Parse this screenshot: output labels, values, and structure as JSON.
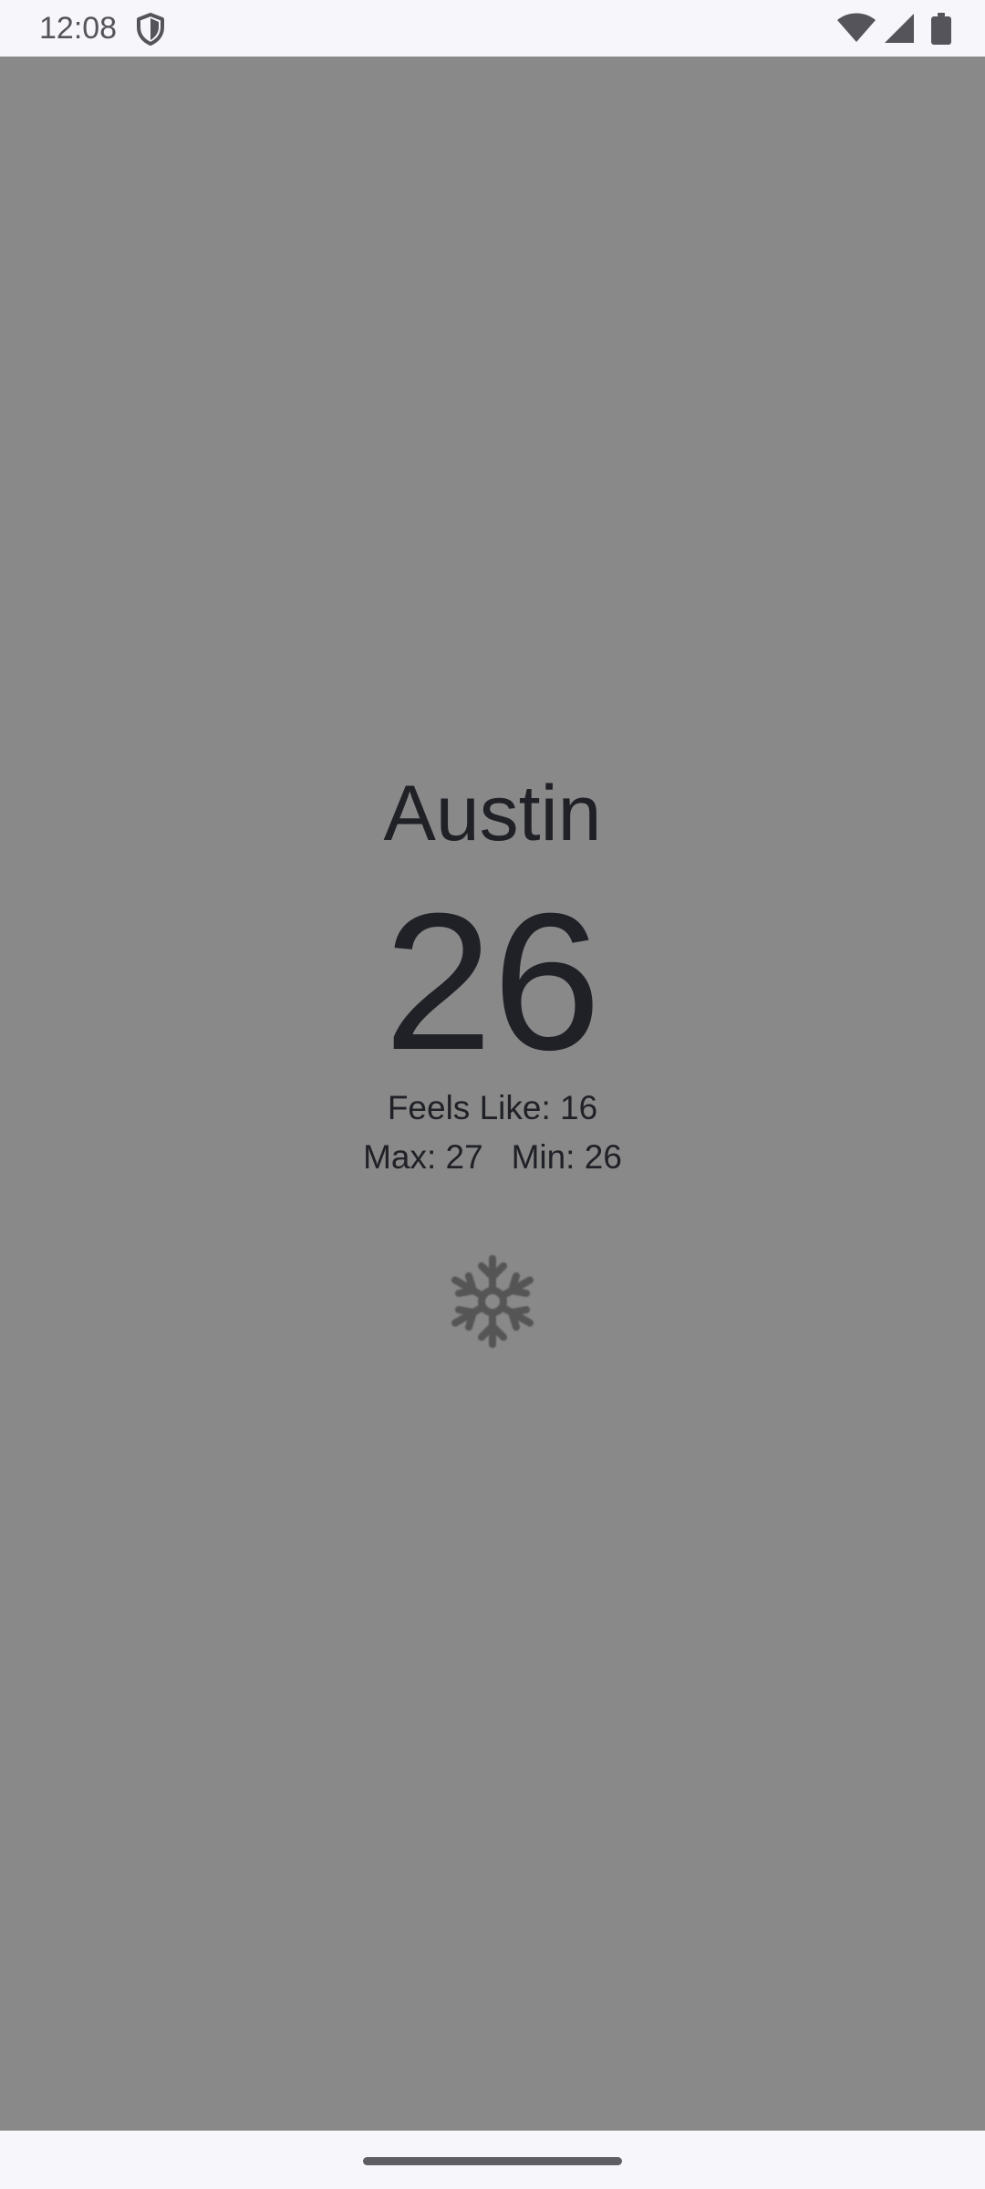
{
  "status_bar": {
    "time": "12:08",
    "left_icon": "shield-icon",
    "right_icons": [
      "wifi-icon",
      "signal-icon",
      "battery-icon"
    ]
  },
  "weather": {
    "city": "Austin",
    "temperature": "26",
    "feels_like": "Feels Like: 16",
    "max": "Max: 27",
    "min": "Min: 26",
    "condition_icon": "snowflake-icon"
  },
  "colors": {
    "background": "#898989",
    "system_bar": "#f6f6fb",
    "primary_text": "#202127",
    "icon": "#555555"
  }
}
